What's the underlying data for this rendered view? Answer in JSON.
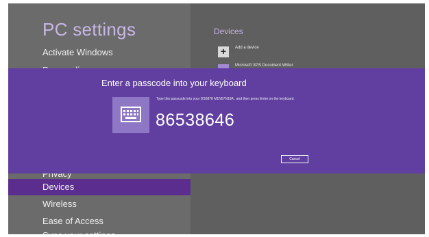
{
  "settings": {
    "title": "PC settings",
    "nav_items": [
      "Activate Windows",
      "Personalize",
      "Privacy",
      "Devices",
      "Wireless",
      "Ease of Access",
      "Sync your settings"
    ],
    "selected": "Devices"
  },
  "devices": {
    "title": "Devices",
    "add_device_label": "Add a device",
    "device_name": "Microsoft XPS Document Writer"
  },
  "passcode_dialog": {
    "title": "Enter a passcode into your keyboard",
    "instruction": "Type this passcode into your DS6878 M1N57N19A      , and then press Enter on the keyboard.",
    "passcode": "86538646",
    "cancel_label": "Cancel",
    "icon": "keyboard-icon"
  },
  "colors": {
    "accent_purple": "#613fa0",
    "selection_purple": "#5b2d8e",
    "pane_gray": "#6b6b6b"
  }
}
